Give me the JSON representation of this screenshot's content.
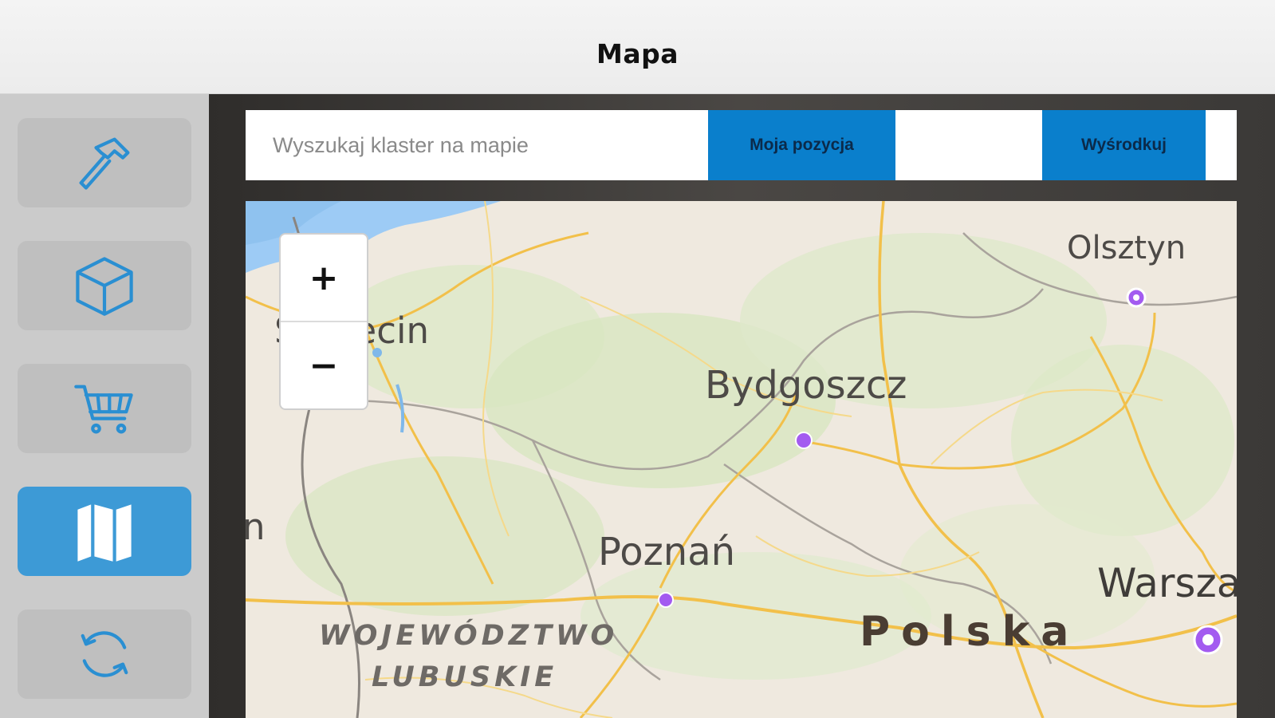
{
  "header": {
    "title": "Mapa"
  },
  "sidebar": {
    "items": [
      {
        "icon": "hammer-icon",
        "active": false
      },
      {
        "icon": "cube-icon",
        "active": false
      },
      {
        "icon": "cart-icon",
        "active": false
      },
      {
        "icon": "map-icon",
        "active": true
      },
      {
        "icon": "sync-icon",
        "active": false
      }
    ]
  },
  "search": {
    "placeholder": "Wyszukaj klaster na mapie",
    "my_position_label": "Moja pozycja",
    "center_label": "Wyśrodkuj"
  },
  "map": {
    "zoom_in_label": "+",
    "zoom_out_label": "−",
    "labels": {
      "szczecin": "Szczecin",
      "olsztyn": "Olsztyn",
      "bydgoszcz": "Bydgoszcz",
      "poznan": "Poznań",
      "warszawa": "Warszawa",
      "polska": "Polska",
      "wojewodztwo": "WOJEWÓDZTWO",
      "lubuskie": "LUBUSKIE",
      "partial_left": "n"
    }
  },
  "colors": {
    "accent": "#0a7fcc",
    "sidebar_active": "#3d9ad6",
    "marker": "#a35bf0"
  }
}
